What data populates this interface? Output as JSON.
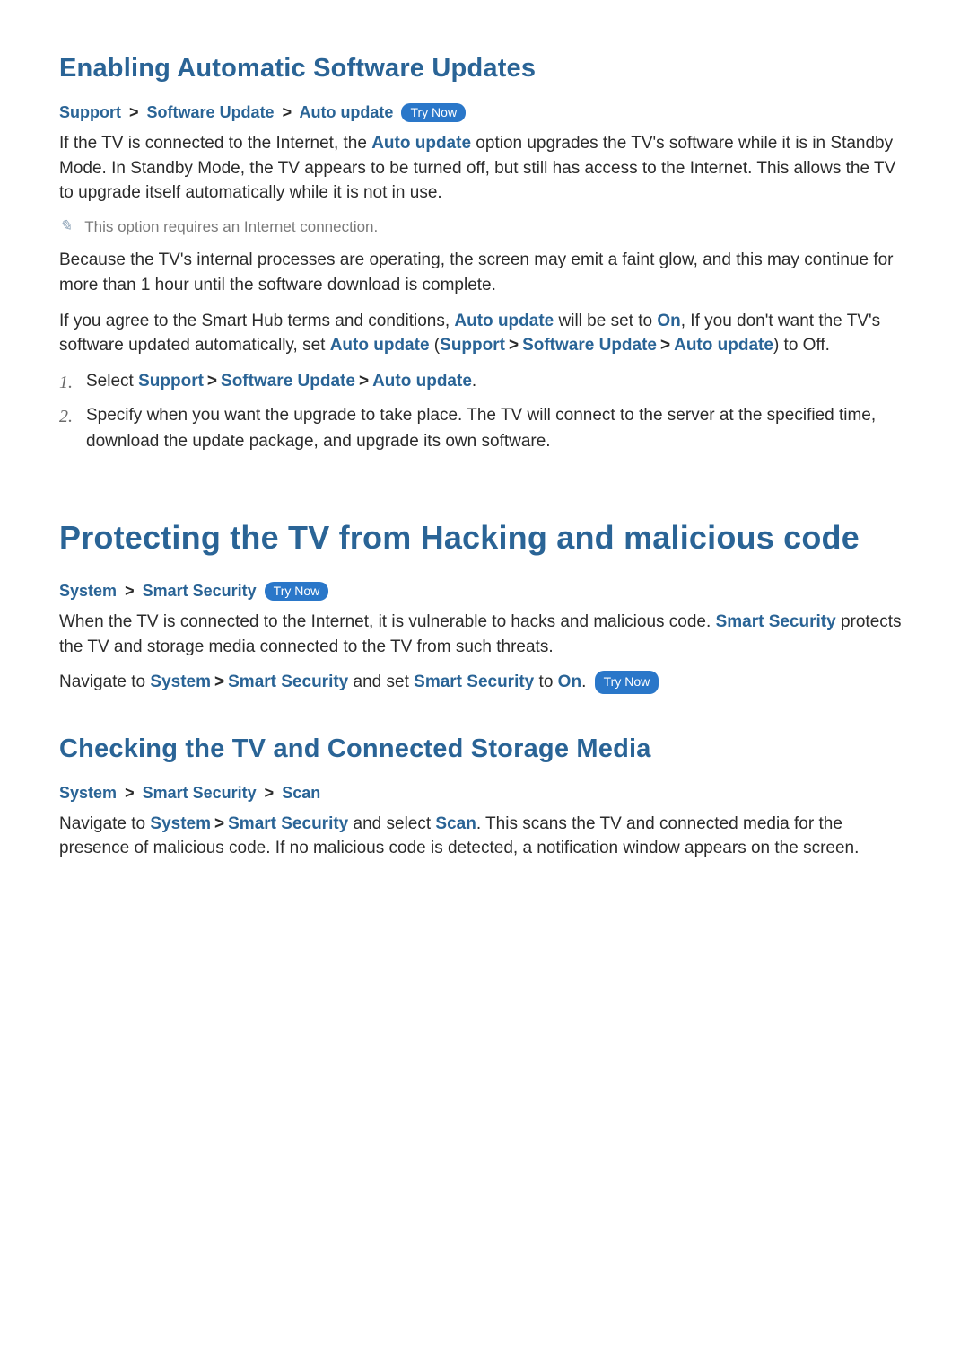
{
  "section1": {
    "title": "Enabling Automatic Software Updates",
    "bc": {
      "a": "Support",
      "b": "Software Update",
      "c": "Auto update",
      "try": "Try Now"
    },
    "p1_a": "If the TV is connected to the Internet, the ",
    "p1_k1": "Auto update",
    "p1_b": " option upgrades the TV's software while it is in Standby Mode. In Standby Mode, the TV appears to be turned off, but still has access to the Internet. This allows the TV to upgrade itself automatically while it is not in use.",
    "note": "This option requires an Internet connection.",
    "p2": "Because the TV's internal processes are operating, the screen may emit a faint glow, and this may continue for more than 1 hour until the software download is complete.",
    "p3_a": "If you agree to the Smart Hub terms and conditions, ",
    "p3_k1": "Auto update",
    "p3_b": " will be set to ",
    "p3_k2": "On",
    "p3_c": ", If you don't want the TV's software updated automatically, set ",
    "p3_k3": "Auto update",
    "p3_d": " (",
    "p3_k4": "Support",
    "p3_k5": "Software Update",
    "p3_k6": "Auto update",
    "p3_e": ") to Off.",
    "step1_a": "Select ",
    "step1_k1": "Support",
    "step1_k2": "Software Update",
    "step1_k3": "Auto update",
    "step1_b": ".",
    "step2": "Specify when you want the upgrade to take place. The TV will connect to the server at the specified time, download the update package, and upgrade its own software."
  },
  "section2": {
    "title": "Protecting the TV from Hacking and malicious code",
    "bc": {
      "a": "System",
      "b": "Smart Security",
      "try": "Try Now"
    },
    "p1_a": "When the TV is connected to the Internet, it is vulnerable to hacks and malicious code. ",
    "p1_k1": "Smart Security",
    "p1_b": " protects the TV and storage media connected to the TV from such threats.",
    "p2_a": "Navigate to ",
    "p2_k1": "System",
    "p2_k2": "Smart Security",
    "p2_b": " and set ",
    "p2_k3": "Smart Security",
    "p2_c": " to ",
    "p2_k4": "On",
    "p2_d": ". ",
    "p2_try": "Try Now"
  },
  "section3": {
    "title": "Checking the TV and Connected Storage Media",
    "bc": {
      "a": "System",
      "b": "Smart Security",
      "c": "Scan"
    },
    "p1_a": "Navigate to ",
    "p1_k1": "System",
    "p1_k2": "Smart Security",
    "p1_b": " and select ",
    "p1_k3": "Scan",
    "p1_c": ". This scans the TV and connected media for the presence of malicious code. If no malicious code is detected, a notification window appears on the screen."
  },
  "sep": ">"
}
